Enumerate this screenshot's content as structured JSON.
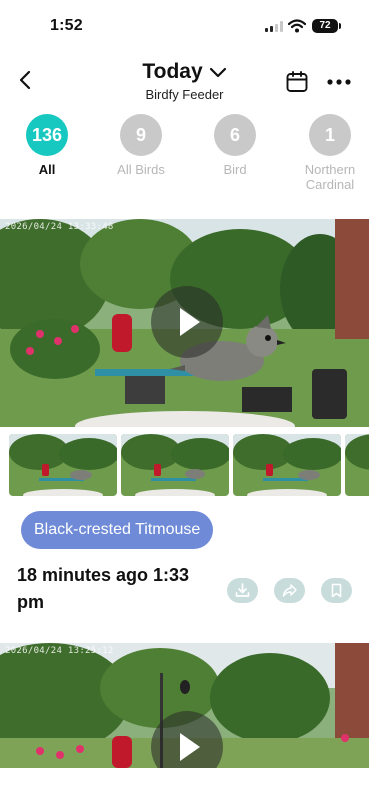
{
  "status_bar": {
    "time": "1:52",
    "battery": "72"
  },
  "header": {
    "title": "Today",
    "subtitle": "Birdfy Feeder"
  },
  "filters": [
    {
      "count": "136",
      "label": "All",
      "active": true
    },
    {
      "count": "9",
      "label": "All Birds",
      "active": false
    },
    {
      "count": "6",
      "label": "Bird",
      "active": false
    },
    {
      "count": "1",
      "label": "Northern Cardinal",
      "active": false
    }
  ],
  "videos": [
    {
      "timestamp": "2026/04/24 13:33:48",
      "species": "Black-crested Titmouse",
      "time_label": "18 minutes ago 1:33 pm"
    },
    {
      "timestamp": "2026/04/24 13:25:12"
    }
  ],
  "icons": [
    "back-icon",
    "chevron-down-icon",
    "calendar-icon",
    "more-icon",
    "play-icon",
    "download-icon",
    "share-icon",
    "bookmark-icon"
  ],
  "colors": {
    "active_filter": "#16c8c0",
    "species_tag": "#6f8bd7",
    "action_button": "#c9dcdc"
  }
}
